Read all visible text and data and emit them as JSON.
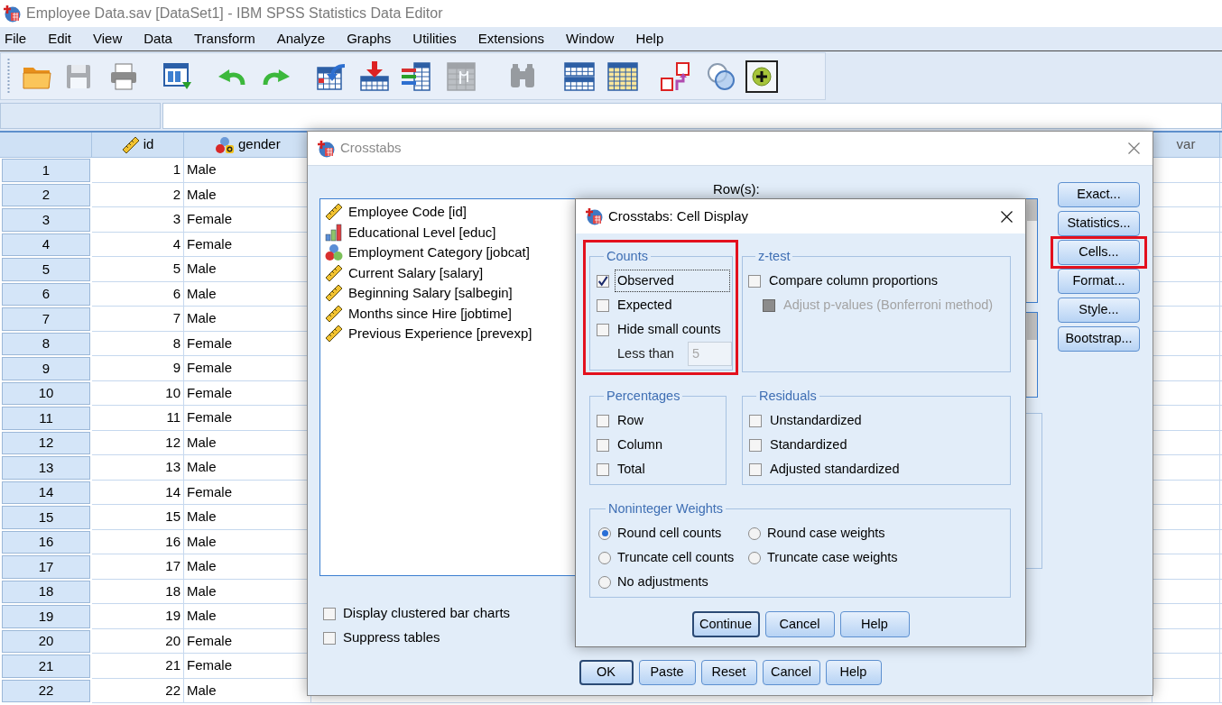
{
  "window": {
    "title": "Employee Data.sav [DataSet1] - IBM SPSS Statistics Data Editor"
  },
  "menu": [
    "File",
    "Edit",
    "View",
    "Data",
    "Transform",
    "Analyze",
    "Graphs",
    "Utilities",
    "Extensions",
    "Window",
    "Help"
  ],
  "toolbar": [
    {
      "disabled": false
    },
    {
      "disabled": true
    },
    {
      "disabled": false
    },
    {
      "disabled": false
    },
    {
      "disabled": false
    },
    {
      "disabled": false
    },
    {
      "disabled": false
    },
    {
      "disabled": false
    },
    {
      "disabled": false
    },
    {
      "disabled": true
    },
    {
      "disabled": true
    },
    {
      "disabled": false
    },
    {
      "disabled": false
    },
    {
      "disabled": false
    },
    {
      "disabled": false
    },
    {
      "disabled": false
    }
  ],
  "data_grid": {
    "columns": [
      {
        "name": "id",
        "kind": "scale"
      },
      {
        "name": "gender",
        "kind": "nominal_string"
      },
      {
        "name": "var",
        "kind": "empty"
      }
    ],
    "rows": [
      {
        "number": "1",
        "id": "1",
        "gender": "Male"
      },
      {
        "number": "2",
        "id": "2",
        "gender": "Male"
      },
      {
        "number": "3",
        "id": "3",
        "gender": "Female"
      },
      {
        "number": "4",
        "id": "4",
        "gender": "Female"
      },
      {
        "number": "5",
        "id": "5",
        "gender": "Male"
      },
      {
        "number": "6",
        "id": "6",
        "gender": "Male"
      },
      {
        "number": "7",
        "id": "7",
        "gender": "Male"
      },
      {
        "number": "8",
        "id": "8",
        "gender": "Female"
      },
      {
        "number": "9",
        "id": "9",
        "gender": "Female"
      },
      {
        "number": "10",
        "id": "10",
        "gender": "Female"
      },
      {
        "number": "11",
        "id": "11",
        "gender": "Female"
      },
      {
        "number": "12",
        "id": "12",
        "gender": "Male"
      },
      {
        "number": "13",
        "id": "13",
        "gender": "Male"
      },
      {
        "number": "14",
        "id": "14",
        "gender": "Female"
      },
      {
        "number": "15",
        "id": "15",
        "gender": "Male"
      },
      {
        "number": "16",
        "id": "16",
        "gender": "Male"
      },
      {
        "number": "17",
        "id": "17",
        "gender": "Male"
      },
      {
        "number": "18",
        "id": "18",
        "gender": "Male"
      },
      {
        "number": "19",
        "id": "19",
        "gender": "Male"
      },
      {
        "number": "20",
        "id": "20",
        "gender": "Female"
      },
      {
        "number": "21",
        "id": "21",
        "gender": "Female"
      },
      {
        "number": "22",
        "id": "22",
        "gender": "Male"
      }
    ]
  },
  "crosstabs": {
    "title": "Crosstabs",
    "variables": [
      {
        "label": "Employee Code [id]",
        "kind": "scale"
      },
      {
        "label": "Educational Level [educ]",
        "kind": "ordinal"
      },
      {
        "label": "Employment Category [jobcat]",
        "kind": "nominal"
      },
      {
        "label": "Current Salary [salary]",
        "kind": "scale"
      },
      {
        "label": "Beginning Salary [salbegin]",
        "kind": "scale"
      },
      {
        "label": "Months since Hire [jobtime]",
        "kind": "scale"
      },
      {
        "label": "Previous Experience [prevexp]",
        "kind": "scale"
      }
    ],
    "rows_label": "Row(s):",
    "side_buttons": [
      {
        "label": "Exact...",
        "highlighted": false
      },
      {
        "label": "Statistics...",
        "highlighted": false
      },
      {
        "label": "Cells...",
        "highlighted": true
      },
      {
        "label": "Format...",
        "highlighted": false
      },
      {
        "label": "Style...",
        "highlighted": false
      },
      {
        "label": "Bootstrap...",
        "highlighted": false
      }
    ],
    "options": [
      {
        "label": "Display clustered bar charts",
        "checked": false
      },
      {
        "label": "Suppress tables",
        "checked": false
      }
    ],
    "buttons": [
      {
        "label": "OK",
        "default": true
      },
      {
        "label": "Paste",
        "default": false
      },
      {
        "label": "Reset",
        "default": false
      },
      {
        "label": "Cancel",
        "default": false
      },
      {
        "label": "Help",
        "default": false
      }
    ]
  },
  "cell_display": {
    "title": "Crosstabs: Cell Display",
    "counts": {
      "title": "Counts",
      "highlighted": true,
      "items": [
        {
          "label": "Observed",
          "checked": true,
          "focused": true
        },
        {
          "label": "Expected",
          "checked": false,
          "focused": false
        },
        {
          "label": "Hide small counts",
          "checked": false,
          "focused": false
        }
      ],
      "less_than": {
        "label": "Less than",
        "value": "5",
        "disabled": true
      }
    },
    "z_test": {
      "title": "z-test",
      "items": [
        {
          "label": "Compare column proportions",
          "checked": false,
          "disabled": false,
          "children": [
            {
              "label": "Adjust p-values (Bonferroni method)",
              "checked": false,
              "disabled": true
            }
          ]
        }
      ]
    },
    "percentages": {
      "title": "Percentages",
      "items": [
        {
          "label": "Row",
          "checked": false
        },
        {
          "label": "Column",
          "checked": false
        },
        {
          "label": "Total",
          "checked": false
        }
      ]
    },
    "residuals": {
      "title": "Residuals",
      "items": [
        {
          "label": "Unstandardized",
          "checked": false
        },
        {
          "label": "Standardized",
          "checked": false
        },
        {
          "label": "Adjusted standardized",
          "checked": false
        }
      ]
    },
    "noninteger_weights": {
      "title": "Noninteger Weights",
      "options": [
        {
          "label": "Round cell counts",
          "selected": true
        },
        {
          "label": "Round case weights",
          "selected": false
        },
        {
          "label": "Truncate cell counts",
          "selected": false
        },
        {
          "label": "Truncate case weights",
          "selected": false
        },
        {
          "label": "No adjustments",
          "selected": false
        }
      ]
    },
    "buttons": [
      {
        "label": "Continue",
        "default": true
      },
      {
        "label": "Cancel",
        "default": false
      },
      {
        "label": "Help",
        "default": false
      }
    ]
  }
}
